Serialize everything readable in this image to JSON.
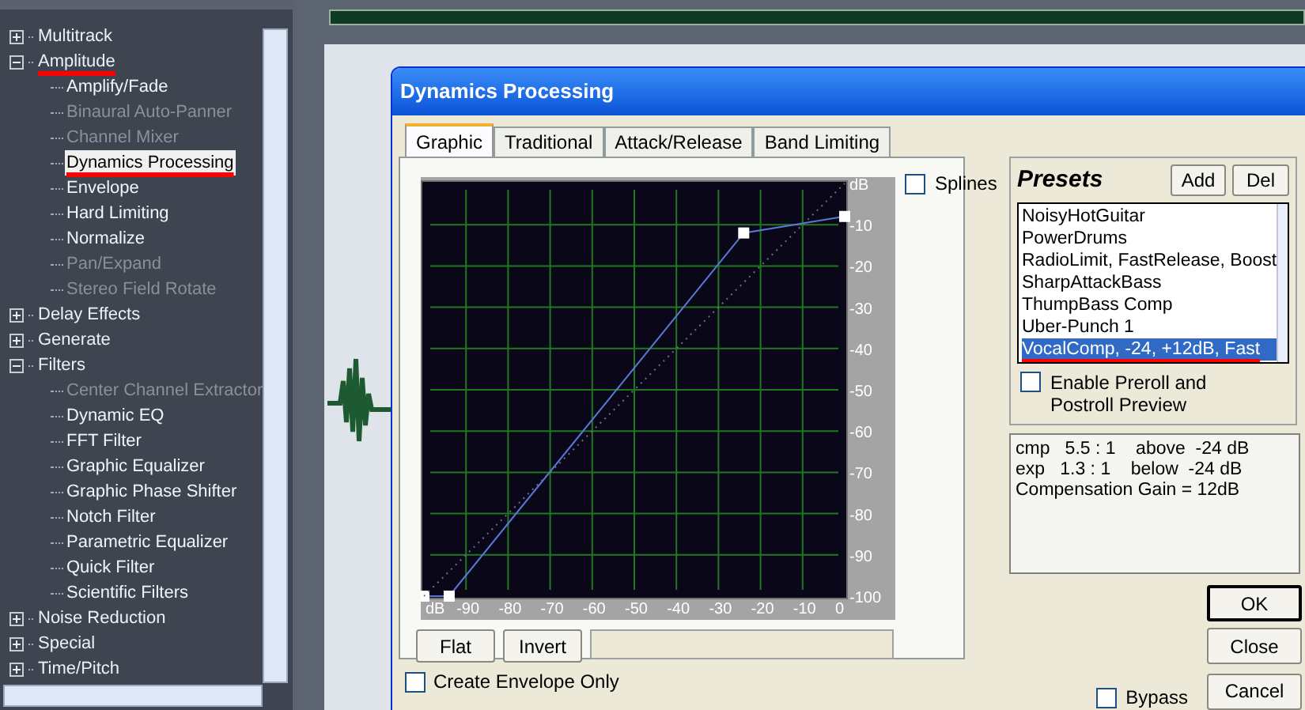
{
  "effects_tree": [
    {
      "label": "Multitrack",
      "expanded": false,
      "underlined": false
    },
    {
      "label": "Amplitude",
      "expanded": true,
      "underlined": true,
      "children": [
        {
          "label": "Amplify/Fade",
          "disabled": false,
          "selected": false,
          "underlined": false
        },
        {
          "label": "Binaural Auto-Panner",
          "disabled": true,
          "selected": false,
          "underlined": false
        },
        {
          "label": "Channel Mixer",
          "disabled": true,
          "selected": false,
          "underlined": false
        },
        {
          "label": "Dynamics Processing",
          "disabled": false,
          "selected": true,
          "underlined": true
        },
        {
          "label": "Envelope",
          "disabled": false,
          "selected": false,
          "underlined": false
        },
        {
          "label": "Hard Limiting",
          "disabled": false,
          "selected": false,
          "underlined": false
        },
        {
          "label": "Normalize",
          "disabled": false,
          "selected": false,
          "underlined": false
        },
        {
          "label": "Pan/Expand",
          "disabled": true,
          "selected": false,
          "underlined": false
        },
        {
          "label": "Stereo Field Rotate",
          "disabled": true,
          "selected": false,
          "underlined": false
        }
      ]
    },
    {
      "label": "Delay Effects",
      "expanded": false,
      "underlined": false
    },
    {
      "label": "Generate",
      "expanded": false,
      "underlined": false
    },
    {
      "label": "Filters",
      "expanded": true,
      "underlined": false,
      "children": [
        {
          "label": "Center Channel Extractor",
          "disabled": true,
          "selected": false,
          "underlined": false
        },
        {
          "label": "Dynamic EQ",
          "disabled": false,
          "selected": false,
          "underlined": false
        },
        {
          "label": "FFT Filter",
          "disabled": false,
          "selected": false,
          "underlined": false
        },
        {
          "label": "Graphic Equalizer",
          "disabled": false,
          "selected": false,
          "underlined": false
        },
        {
          "label": "Graphic Phase Shifter",
          "disabled": false,
          "selected": false,
          "underlined": false
        },
        {
          "label": "Notch Filter",
          "disabled": false,
          "selected": false,
          "underlined": false
        },
        {
          "label": "Parametric Equalizer",
          "disabled": false,
          "selected": false,
          "underlined": false
        },
        {
          "label": "Quick Filter",
          "disabled": false,
          "selected": false,
          "underlined": false
        },
        {
          "label": "Scientific Filters",
          "disabled": false,
          "selected": false,
          "underlined": false
        }
      ]
    },
    {
      "label": "Noise Reduction",
      "expanded": false,
      "underlined": false
    },
    {
      "label": "Special",
      "expanded": false,
      "underlined": false
    },
    {
      "label": "Time/Pitch",
      "expanded": false,
      "underlined": false
    }
  ],
  "dialog": {
    "title": "Dynamics Processing",
    "tabs": [
      {
        "label": "Graphic",
        "selected": true
      },
      {
        "label": "Traditional",
        "selected": false
      },
      {
        "label": "Attack/Release",
        "selected": false
      },
      {
        "label": "Band Limiting",
        "selected": false
      }
    ],
    "chart_data": {
      "type": "line",
      "x": [
        -100,
        -94,
        -24,
        0
      ],
      "series": [
        {
          "color": "#5b78d8",
          "marker": "square",
          "line_style": "solid",
          "values": [
            -100,
            -100,
            -12,
            -8
          ]
        },
        {
          "color": "#6a7090",
          "line_style": "dotted",
          "values": [
            -100,
            -94,
            -24,
            0
          ]
        }
      ],
      "grid": true,
      "xlim": [
        -100,
        0
      ],
      "ylim": [
        -100,
        0
      ],
      "xticks": [
        {
          "value": -100,
          "label": "dB"
        },
        -90,
        -80,
        -70,
        -60,
        -50,
        -40,
        -30,
        -20,
        -10,
        0
      ],
      "yticks": [
        {
          "value": 0,
          "label": "dB"
        },
        -10,
        -20,
        -30,
        -40,
        -50,
        -60,
        -70,
        -80,
        -90,
        -100
      ]
    },
    "splines": {
      "label": "Splines",
      "checked": false
    },
    "buttons": [
      "Flat",
      "Invert"
    ],
    "create_envelope_only": {
      "label": "Create Envelope Only",
      "checked": false
    },
    "presets": {
      "title": "Presets",
      "add": "Add",
      "del": "Del",
      "items": [
        {
          "label": "NoisyHotGuitar",
          "selected": false,
          "underlined": false
        },
        {
          "label": "PowerDrums",
          "selected": false,
          "underlined": false
        },
        {
          "label": "RadioLimit, FastRelease, Boost",
          "selected": false,
          "underlined": false
        },
        {
          "label": "SharpAttackBass",
          "selected": false,
          "underlined": false
        },
        {
          "label": "ThumpBass Comp",
          "selected": false,
          "underlined": false
        },
        {
          "label": "Uber-Punch 1",
          "selected": false,
          "underlined": false
        },
        {
          "label": "VocalComp, -24, +12dB, Fast",
          "selected": true,
          "underlined": true
        }
      ],
      "preroll": {
        "label": "Enable Preroll and Postroll Preview",
        "checked": false
      }
    },
    "info_lines": [
      "cmp   5.5 : 1    above  -24 dB",
      "exp   1.3 : 1    below  -24 dB",
      "Compensation Gain = 12dB"
    ],
    "ok": "OK",
    "close": "Close",
    "cancel": "Cancel",
    "bypass": {
      "label": "Bypass",
      "checked": false
    }
  }
}
